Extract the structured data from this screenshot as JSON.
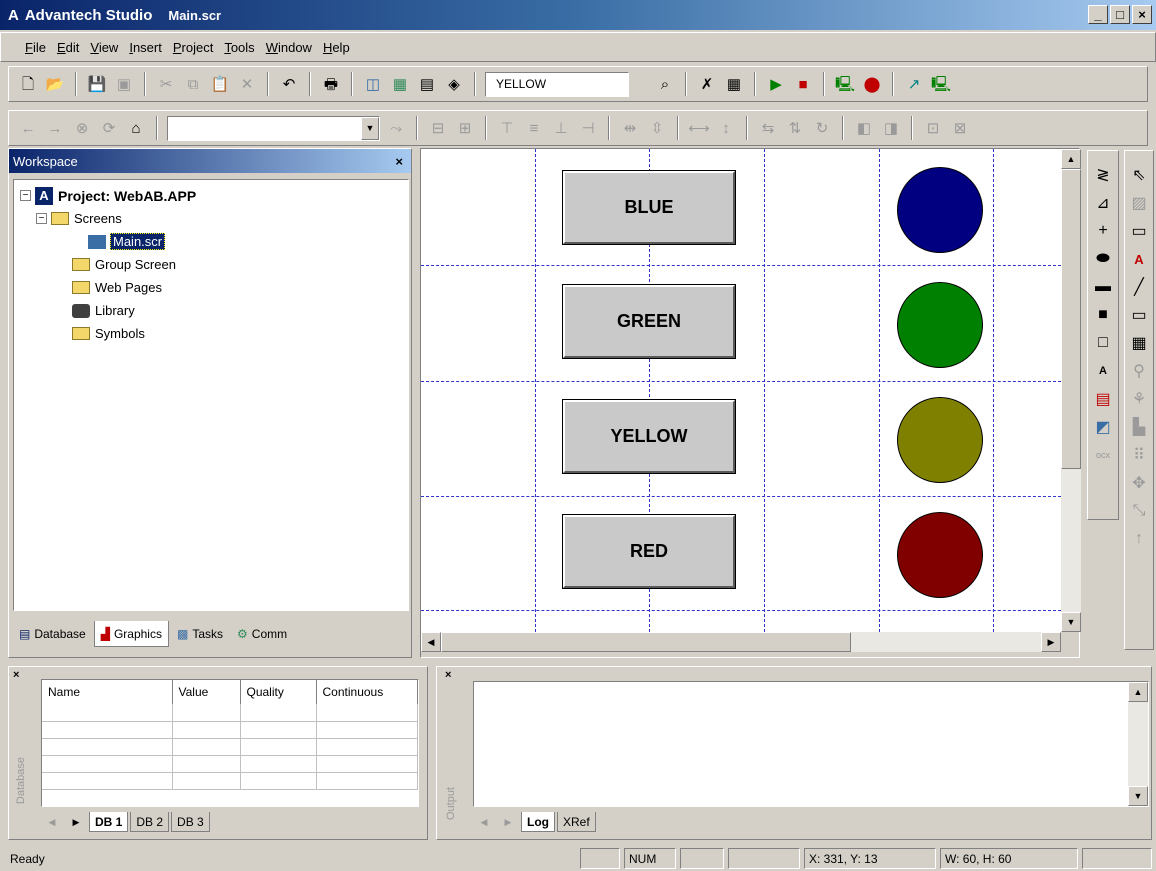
{
  "window": {
    "title": "Advantech Studio",
    "document": "Main.scr",
    "min": "_",
    "max": "□",
    "close": "×"
  },
  "menu": [
    "File",
    "Edit",
    "View",
    "Insert",
    "Project",
    "Tools",
    "Window",
    "Help"
  ],
  "toolbar": {
    "combo_value": "YELLOW"
  },
  "workspace": {
    "title": "Workspace",
    "project": "Project: WebAB.APP",
    "screens": "Screens",
    "main": "Main.scr",
    "group_screen": "Group Screen",
    "web_pages": "Web Pages",
    "library": "Library",
    "symbols": "Symbols",
    "tabs": [
      "Database",
      "Graphics",
      "Tasks",
      "Comm"
    ]
  },
  "canvas": {
    "buttons": [
      "BLUE",
      "GREEN",
      "YELLOW",
      "RED"
    ],
    "circle_colors": [
      "#000080",
      "#008000",
      "#808000",
      "#800000"
    ]
  },
  "watch": {
    "columns": [
      "Name",
      "Value",
      "Quality",
      "Continuous"
    ],
    "side_label": "Database",
    "tabs": [
      "DB 1",
      "DB 2",
      "DB 3"
    ]
  },
  "output": {
    "side_label": "Output",
    "tabs": [
      "Log",
      "XRef"
    ]
  },
  "status": {
    "ready": "Ready",
    "num": "NUM",
    "coords": "X: 331, Y: 13",
    "size": "W: 60, H: 60"
  }
}
